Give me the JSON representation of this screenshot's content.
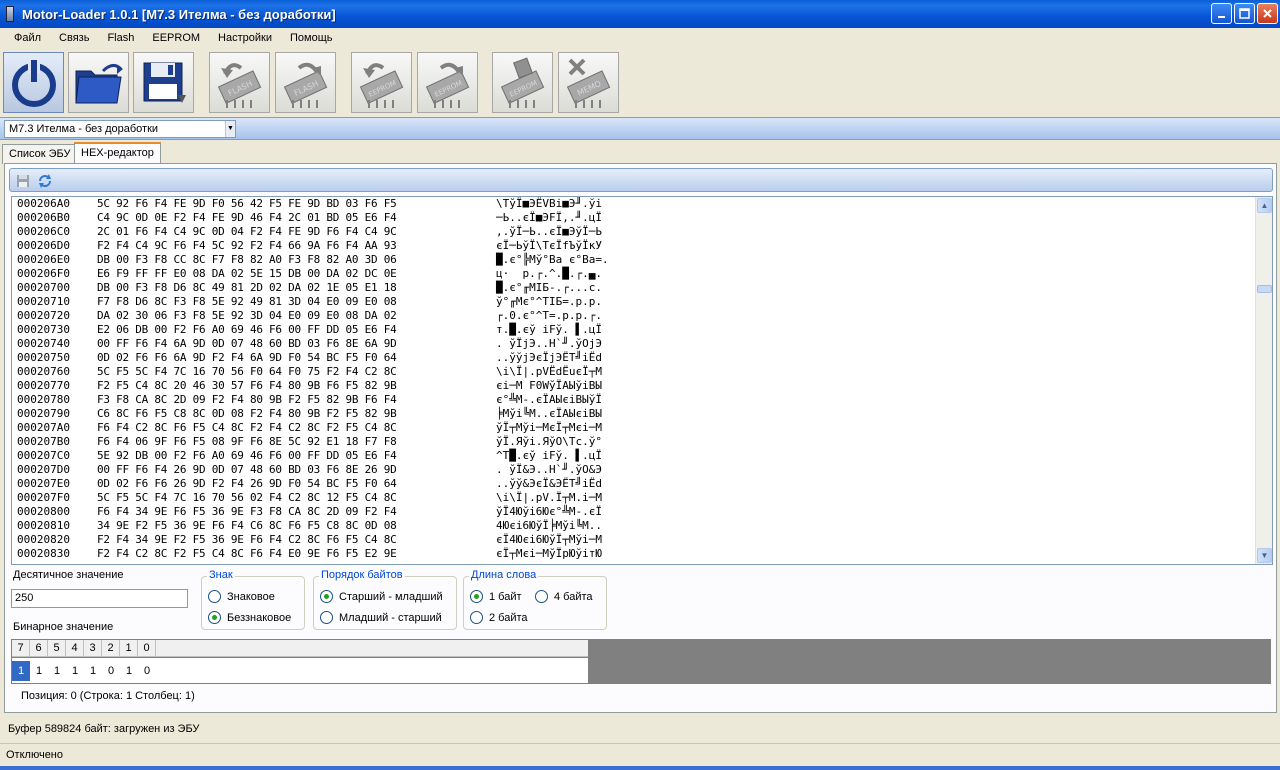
{
  "window": {
    "title": "Motor-Loader 1.0.1 [M7.3 Ителма - без доработки]"
  },
  "menu": [
    "Файл",
    "Связь",
    "Flash",
    "EEPROM",
    "Настройки",
    "Помощь"
  ],
  "toolbar": {
    "buttons": [
      "power-icon",
      "open-folder-icon",
      "save-floppy-icon",
      "read-flash-icon",
      "write-flash-icon",
      "read-eeprom-icon",
      "write-eeprom-icon",
      "erase-eeprom-icon",
      "erase-memo-icon"
    ],
    "chip_labels": {
      "flash": "FLASH",
      "eeprom": "EEPROM",
      "memo": "MEMO"
    }
  },
  "ecu_select": {
    "value": "M7.3 Ителма - без доработки"
  },
  "tabs": [
    {
      "label": "Список ЭБУ",
      "selected": false
    },
    {
      "label": "HEX-редактор",
      "selected": true
    }
  ],
  "hex": {
    "rows": [
      {
        "addr": "000206A0",
        "bytes": "5C 92 F6 F4 FE 9D F0 56 42 F5 FE 9D BD 03 F6 F5",
        "ascii": "\\ТўЇ■ЭЁVBі■Э╜.ўі"
      },
      {
        "addr": "000206B0",
        "bytes": "C4 9C 0D 0E F2 F4 FE 9D 46 F4 2C 01 BD 05 E6 F4",
        "ascii": "─Ь..єЇ■ЭFЇ,.╜.цЇ"
      },
      {
        "addr": "000206C0",
        "bytes": "2C 01 F6 F4 C4 9C 0D 04 F2 F4 FE 9D F6 F4 C4 9C",
        "ascii": ",.ўЇ─Ь..єЇ■ЭўЇ─Ь"
      },
      {
        "addr": "000206D0",
        "bytes": "F2 F4 C4 9C F6 F4 5C 92 F2 F4 66 9A F6 F4 AA 93",
        "ascii": "єЇ─ЬўЇ\\ТєЇfЪўЇкУ"
      },
      {
        "addr": "000206E0",
        "bytes": "DB 00 F3 F8 CC 8C F7 F8 82 A0 F3 F8 82 A0 3D 06",
        "ascii": "█.є°╠Мў°Ва є°Ва=."
      },
      {
        "addr": "000206F0",
        "bytes": "E6 F9 FF FF E0 08 DA 02 5E 15 DB 00 DA 02 DC 0E",
        "ascii": "ц·  р.┌.^.█.┌.▄."
      },
      {
        "addr": "00020700",
        "bytes": "DB 00 F3 F8 D6 8C 49 81 2D 02 DA 02 1E 05 E1 18",
        "ascii": "█.є°╓МIБ-.┌...с."
      },
      {
        "addr": "00020710",
        "bytes": "F7 F8 D6 8C F3 F8 5E 92 49 81 3D 04 E0 09 E0 08",
        "ascii": "ў°╓Мє°^ТIБ=.р.р."
      },
      {
        "addr": "00020720",
        "bytes": "DA 02 30 06 F3 F8 5E 92 3D 04 E0 09 E0 08 DA 02",
        "ascii": "┌.0.є°^Т=.р.р.┌."
      },
      {
        "addr": "00020730",
        "bytes": "E2 06 DB 00 F2 F6 A0 69 46 F6 00 FF DD 05 E6 F4",
        "ascii": "т.█.єў iFў. ▌.цЇ"
      },
      {
        "addr": "00020740",
        "bytes": "00 FF F6 F4 6A 9D 0D 07 48 60 BD 03 F6 8E 6A 9D",
        "ascii": ". ўЇjЭ..H`╜.ўОjЭ"
      },
      {
        "addr": "00020750",
        "bytes": "0D 02 F6 F6 6A 9D F2 F4 6A 9D F0 54 BC F5 F0 64",
        "ascii": "..ўўjЭєЇjЭЁT╝іЁd"
      },
      {
        "addr": "00020760",
        "bytes": "5C F5 5C F4 7C 16 70 56 F0 64 F0 75 F2 F4 C2 8C",
        "ascii": "\\і\\Ї|.pVЁdЁuєЇ┬М"
      },
      {
        "addr": "00020770",
        "bytes": "F2 F5 C4 8C 20 46 30 57 F6 F4 80 9B F6 F5 82 9B",
        "ascii": "єі─М F0WўЇАЫўіВЫ"
      },
      {
        "addr": "00020780",
        "bytes": "F3 F8 CA 8C 2D 09 F2 F4 80 9B F2 F5 82 9B F6 F4",
        "ascii": "є°╩М-.єЇАЫєіВЫўЇ"
      },
      {
        "addr": "00020790",
        "bytes": "C6 8C F6 F5 C8 8C 0D 08 F2 F4 80 9B F2 F5 82 9B",
        "ascii": "╞Мўі╚М..єЇАЫєіВЫ"
      },
      {
        "addr": "000207A0",
        "bytes": "F6 F4 C2 8C F6 F5 C4 8C F2 F4 C2 8C F2 F5 C4 8C",
        "ascii": "ўЇ┬Мўі─МєЇ┬Мєі─М"
      },
      {
        "addr": "000207B0",
        "bytes": "F6 F4 06 9F F6 F5 08 9F F6 8E 5C 92 E1 18 F7 F8",
        "ascii": "ўЇ.Яўі.ЯўО\\Тс.ў°"
      },
      {
        "addr": "000207C0",
        "bytes": "5E 92 DB 00 F2 F6 A0 69 46 F6 00 FF DD 05 E6 F4",
        "ascii": "^Т█.єў iFў. ▌.цЇ"
      },
      {
        "addr": "000207D0",
        "bytes": "00 FF F6 F4 26 9D 0D 07 48 60 BD 03 F6 8E 26 9D",
        "ascii": ". ўЇ&Э..H`╜.ўО&Э"
      },
      {
        "addr": "000207E0",
        "bytes": "0D 02 F6 F6 26 9D F2 F4 26 9D F0 54 BC F5 F0 64",
        "ascii": "..ўў&ЭєЇ&ЭЁT╝іЁd"
      },
      {
        "addr": "000207F0",
        "bytes": "5C F5 5C F4 7C 16 70 56 02 F4 C2 8C 12 F5 C4 8C",
        "ascii": "\\і\\Ї|.pV.Ї┬М.і─М"
      },
      {
        "addr": "00020800",
        "bytes": "F6 F4 34 9E F6 F5 36 9E F3 F8 CA 8C 2D 09 F2 F4",
        "ascii": "ўЇ4Юўі6Ює°╩М-.єЇ"
      },
      {
        "addr": "00020810",
        "bytes": "34 9E F2 F5 36 9E F6 F4 C6 8C F6 F5 C8 8C 0D 08",
        "ascii": "4Юєі6ЮўЇ╞Мўі╚М.."
      },
      {
        "addr": "00020820",
        "bytes": "F2 F4 34 9E F2 F5 36 9E F6 F4 C2 8C F6 F5 C4 8C",
        "ascii": "єЇ4Юєі6ЮўЇ┬Мўі─М"
      },
      {
        "addr": "00020830",
        "bytes": "F2 F4 C2 8C F2 F5 C4 8C F6 F4 E0 9E F6 F5 E2 9E",
        "ascii": "єЇ┬Мєі─МўЇрЮўітЮ"
      }
    ]
  },
  "decimal": {
    "label": "Десятичное значение",
    "value": "250"
  },
  "sign": {
    "title": "Знак",
    "options": [
      "Знаковое",
      "Беззнаковое"
    ],
    "selected": 1
  },
  "byte_order": {
    "title": "Порядок байтов",
    "options": [
      "Старший - младший",
      "Младший - старший"
    ],
    "selected": 0
  },
  "word_length": {
    "title": "Длина слова",
    "options": [
      "1 байт",
      "4 байта",
      "2 байта"
    ],
    "selected": 0
  },
  "binary": {
    "label": "Бинарное значение",
    "headers": [
      "7",
      "6",
      "5",
      "4",
      "3",
      "2",
      "1",
      "0"
    ],
    "bits": [
      "1",
      "1",
      "1",
      "1",
      "1",
      "0",
      "1",
      "0"
    ]
  },
  "position": "Позиция: 0  (Строка: 1 Столбец: 1)",
  "buffer_status": "Буфер 589824 байт: загружен из ЭБУ",
  "connection_status": "Отключено",
  "colors": {
    "title_bar": "#0a5fd8",
    "accent": "#316ac5",
    "radio_checked": "#21a121",
    "group_title": "#0046d5"
  }
}
